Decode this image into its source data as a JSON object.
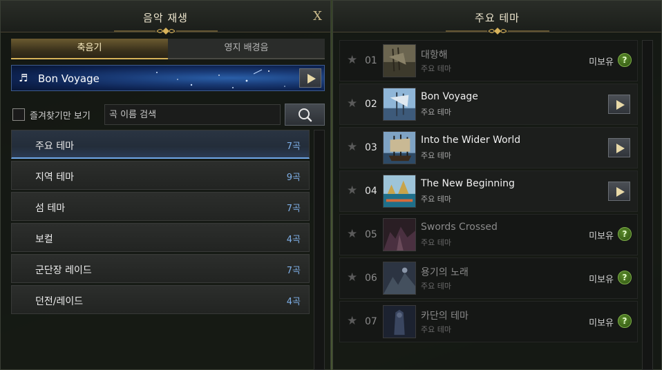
{
  "left_panel": {
    "title": "음악 재생",
    "close_label": "X",
    "tabs": [
      {
        "label": "축음기",
        "active": true
      },
      {
        "label": "영지 배경음",
        "active": false
      }
    ],
    "now_playing": {
      "title": "Bon Voyage",
      "note_icon": "♬"
    },
    "favorites_only_label": "즐겨찾기만 보기",
    "search_placeholder": "곡 이름 검색",
    "categories": [
      {
        "name": "주요 테마",
        "count": "7곡",
        "active": true
      },
      {
        "name": "지역 테마",
        "count": "9곡",
        "active": false
      },
      {
        "name": "섬 테마",
        "count": "7곡",
        "active": false
      },
      {
        "name": "보컬",
        "count": "4곡",
        "active": false
      },
      {
        "name": "군단장 레이드",
        "count": "7곡",
        "active": false
      },
      {
        "name": "던전/레이드",
        "count": "4곡",
        "active": false
      }
    ]
  },
  "right_panel": {
    "title": "주요 테마",
    "tracks": [
      {
        "num": "01",
        "title": "대항해",
        "subtitle": "주요 테마",
        "owned": false,
        "status": "미보유",
        "help": "?"
      },
      {
        "num": "02",
        "title": "Bon Voyage",
        "subtitle": "주요 테마",
        "owned": true
      },
      {
        "num": "03",
        "title": "Into the Wider World",
        "subtitle": "주요 테마",
        "owned": true
      },
      {
        "num": "04",
        "title": "The New Beginning",
        "subtitle": "주요 테마",
        "owned": true
      },
      {
        "num": "05",
        "title": "Swords Crossed",
        "subtitle": "주요 테마",
        "owned": false,
        "status": "미보유",
        "help": "?"
      },
      {
        "num": "06",
        "title": "용기의 노래",
        "subtitle": "주요 테마",
        "owned": false,
        "status": "미보유",
        "help": "?"
      },
      {
        "num": "07",
        "title": "카단의 테마",
        "subtitle": "주요 테마",
        "owned": false,
        "status": "미보유",
        "help": "?"
      }
    ]
  },
  "colors": {
    "accent_gold": "#d8b35a",
    "active_blue": "#6fa7e8",
    "count_blue": "#7fb0e8",
    "help_green": "#4e7d22"
  }
}
